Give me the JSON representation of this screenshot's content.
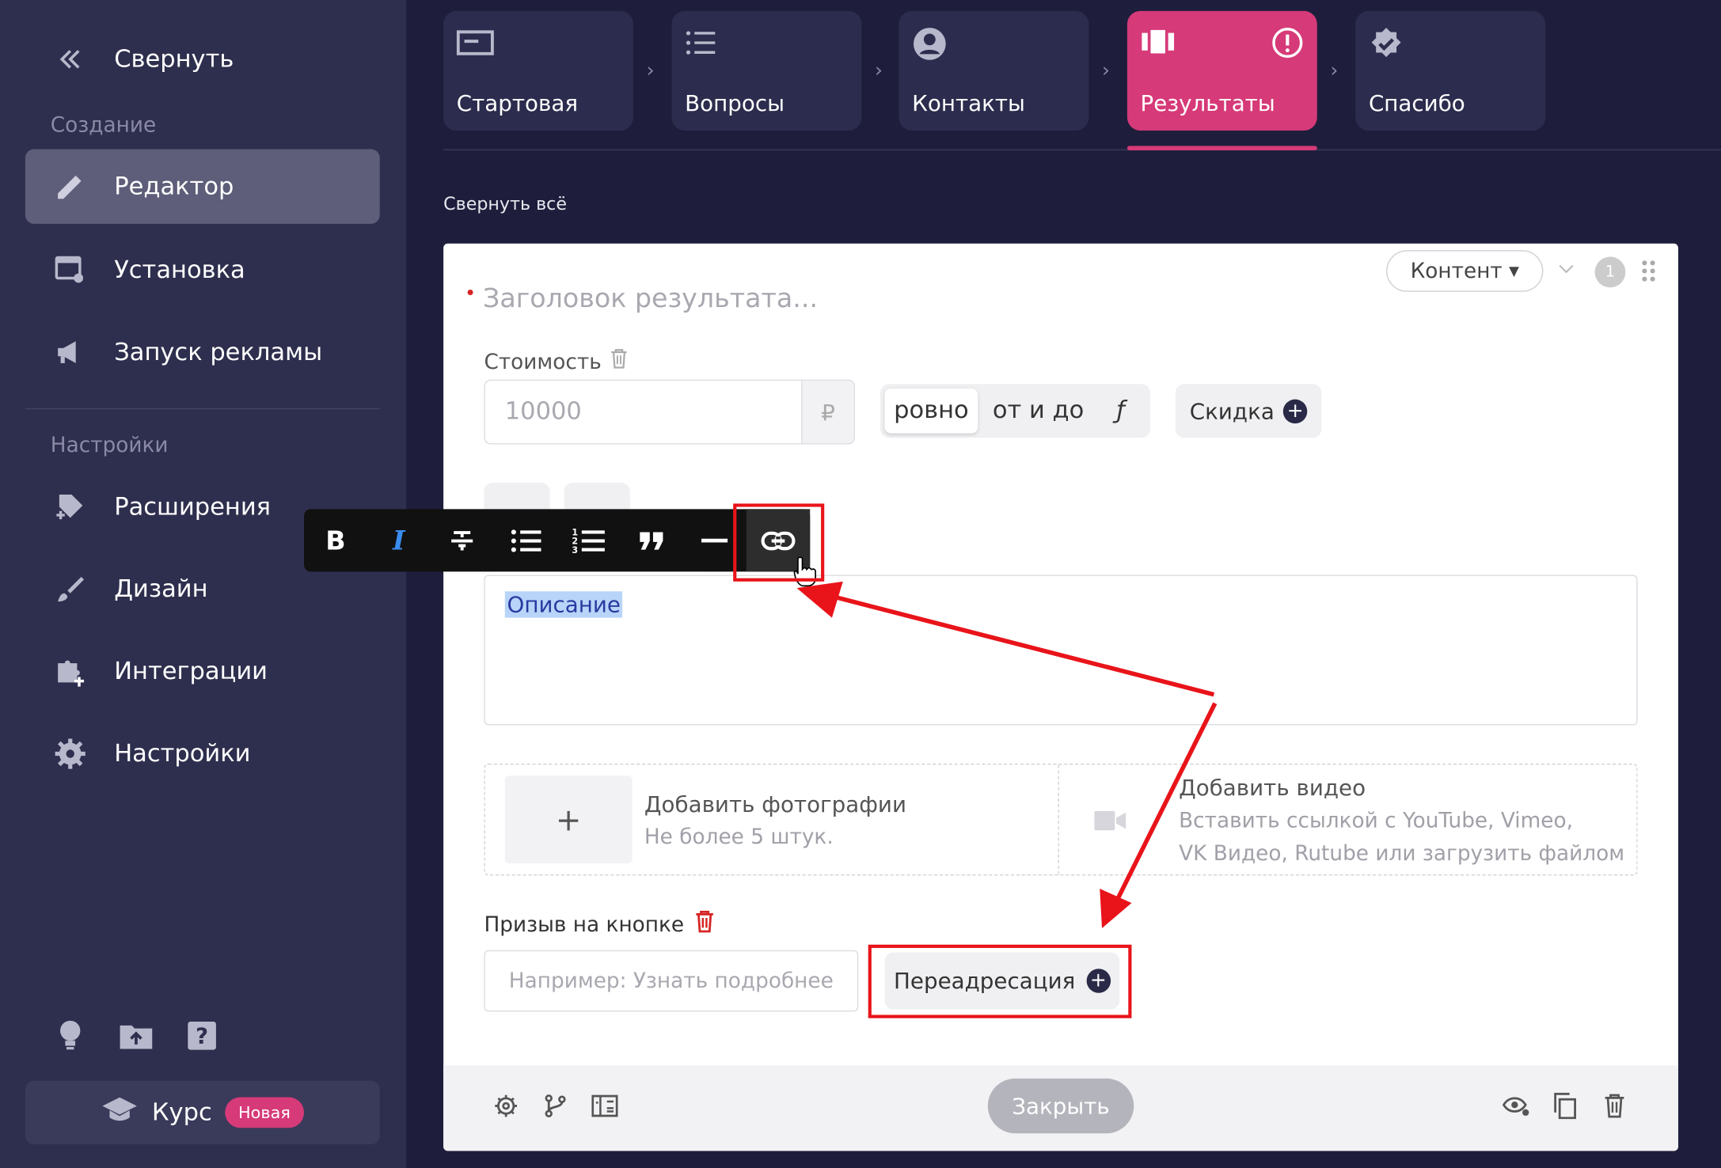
{
  "sidebar": {
    "collapse": "Свернуть",
    "section_create": "Создание",
    "items_create": [
      "Редактор",
      "Установка",
      "Запуск рекламы"
    ],
    "section_settings": "Настройки",
    "items_settings": [
      "Расширения",
      "Дизайн",
      "Интеграции",
      "Настройки"
    ],
    "course_label": "Курс",
    "course_badge": "Новая"
  },
  "tabs": [
    "Стартовая",
    "Вопросы",
    "Контакты",
    "Результаты",
    "Спасибо"
  ],
  "active_tab": "Результаты",
  "collapse_all": "Свернуть всё",
  "result_card": {
    "content_dropdown": "Контент",
    "order_badge": "1",
    "title_placeholder": "Заголовок результата...",
    "cost_label": "Стоимость",
    "price_placeholder": "10000",
    "currency": "₽",
    "price_mode": [
      "ровно",
      "от и до",
      "ƒ"
    ],
    "price_mode_selected": "ровно",
    "discount_button": "Скидка",
    "description": "Описание",
    "add_photos": "Добавить фотографии",
    "photos_hint": "Не более 5 штук.",
    "add_video": "Добавить видео",
    "video_hint_1": "Вставить ссылкой с YouTube, Vimeo,",
    "video_hint_2": "VK Видео, Rutube или загрузить файлом",
    "cta_label": "Призыв на кнопке",
    "cta_placeholder": "Например: Узнать подробнее",
    "redirect_button": "Переадресация",
    "close_button": "Закрыть"
  },
  "format_toolbar": [
    "bold",
    "italic",
    "strikethrough",
    "bullet-list",
    "numbered-list",
    "quote",
    "horizontal-rule",
    "link"
  ],
  "colors": {
    "accent": "#d63a78",
    "sidebar": "#2e2e4e",
    "background": "#1e1e3c",
    "annotation": "#e8141a"
  }
}
